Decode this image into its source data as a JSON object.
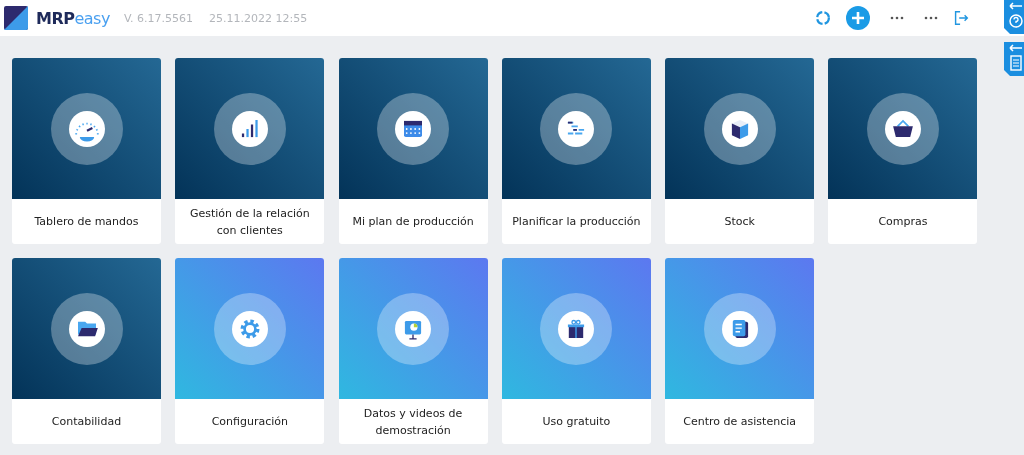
{
  "header": {
    "logo": {
      "part_1": "MRP",
      "part_2": "easy"
    },
    "version": "V. 6.17.5561",
    "datetime": "25.11.2022 12:55"
  },
  "tiles": [
    {
      "label": "Tablero de mandos",
      "kind": "dark"
    },
    {
      "label": "Gestión de la relación con clientes",
      "kind": "dark"
    },
    {
      "label": "Mi plan de producción",
      "kind": "dark"
    },
    {
      "label": "Planificar la producción",
      "kind": "dark"
    },
    {
      "label": "Stock",
      "kind": "dark"
    },
    {
      "label": "Compras",
      "kind": "dark"
    },
    {
      "label": "Contabilidad",
      "kind": "dark"
    },
    {
      "label": "Configuración",
      "kind": "light"
    },
    {
      "label": "Datos y videos de demostración",
      "kind": "light"
    },
    {
      "label": "Uso gratuito",
      "kind": "light"
    },
    {
      "label": "Centro de asistencia",
      "kind": "light"
    }
  ]
}
